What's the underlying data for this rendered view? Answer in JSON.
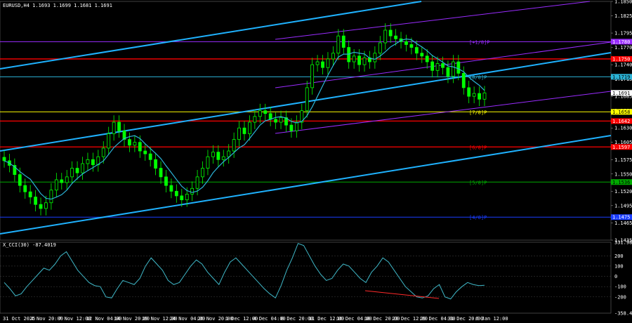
{
  "header": {
    "symbol_line": "EURUSD,H4  1.1693 1.1699 1.1681 1.1691",
    "cci_title": "X_CCI(30) -87.4019"
  },
  "colors": {
    "background": "#000000",
    "bull": "#00ff00",
    "bear": "#00ff00",
    "ma": "#2bb3d6",
    "channel": "#1fb2ff",
    "purple": "#9a2cff",
    "red_level": "#ff0000",
    "yellow_level": "#ffff00",
    "green_level": "#00aa00",
    "blue_level": "#1a3dff",
    "cci_line": "#3fb8c8",
    "div_line": "#ff2a2a"
  },
  "price_axis": {
    "min": 1.1435,
    "max": 1.185,
    "ticks": [
      "1.1850",
      "1.1825",
      "1.1795",
      "1.1770",
      "1.1740",
      "1.1715",
      "1.1685",
      "1.1660",
      "1.1630",
      "1.1605",
      "1.1575",
      "1.1550",
      "1.1520",
      "1.1495",
      "1.1465",
      "1.1435"
    ],
    "current_price": "1.1691"
  },
  "murray_levels": [
    {
      "price": 1.178,
      "tag": "[+1/8]P",
      "label": "1.1780",
      "color": "#9a2cff"
    },
    {
      "price": 1.175,
      "tag": "",
      "label": "1.1750",
      "color": "#ff0000"
    },
    {
      "price": 1.1719,
      "tag": "[8/8]P",
      "label": "1.1719",
      "color": "#2bb3d6"
    },
    {
      "price": 1.1658,
      "tag": "[7/8]P",
      "label": "1.1658",
      "color": "#ffff00"
    },
    {
      "price": 1.1642,
      "tag": "",
      "label": "1.1642",
      "color": "#ff0000"
    },
    {
      "price": 1.1597,
      "tag": "[6/8]P",
      "label": "1.1597",
      "color": "#ff0000"
    },
    {
      "price": 1.1536,
      "tag": "[5/8]P",
      "label": "1.1536",
      "color": "#00aa00"
    },
    {
      "price": 1.1475,
      "tag": "[4/8]P",
      "label": "1.1475",
      "color": "#1a3dff"
    }
  ],
  "time_axis": [
    "31 Oct 2025",
    "4 Nov 20:00",
    "7 Nov 12:00",
    "12 Nov 04:00",
    "14 Nov 20:00",
    "19 Nov 12:00",
    "24 Nov 04:00",
    "26 Nov 20:00",
    "1 Dec 12:00",
    "4 Dec 04:00",
    "8 Dec 20:00",
    "11 Dec 12:00",
    "16 Dec 04:00",
    "18 Dec 20:00",
    "23 Dec 12:00",
    "29 Dec 04:00",
    "31 Dec 20:00",
    "6 Jan 12:00"
  ],
  "cci_axis": {
    "ticks": [
      "331.986",
      "200",
      "100",
      "0",
      "-100",
      "-200",
      "-358.438"
    ]
  },
  "close_series": [
    1.1573,
    1.1565,
    1.1549,
    1.153,
    1.1519,
    1.151,
    1.1497,
    1.149,
    1.15,
    1.1522,
    1.154,
    1.1535,
    1.1545,
    1.156,
    1.1552,
    1.1568,
    1.1575,
    1.1566,
    1.158,
    1.1595,
    1.162,
    1.164,
    1.1625,
    1.161,
    1.16,
    1.1605,
    1.159,
    1.1585,
    1.1575,
    1.156,
    1.1545,
    1.153,
    1.152,
    1.1512,
    1.1505,
    1.1515,
    1.1525,
    1.1545,
    1.156,
    1.158,
    1.1588,
    1.1575,
    1.158,
    1.159,
    1.161,
    1.163,
    1.162,
    1.164,
    1.165,
    1.166,
    1.1655,
    1.1645,
    1.164,
    1.1648,
    1.1635,
    1.1625,
    1.164,
    1.166,
    1.17,
    1.174,
    1.1745,
    1.1735,
    1.175,
    1.176,
    1.179,
    1.177,
    1.1745,
    1.1755,
    1.174,
    1.1752,
    1.1745,
    1.176,
    1.1778,
    1.18,
    1.179,
    1.1785,
    1.178,
    1.1775,
    1.177,
    1.176,
    1.1755,
    1.1745,
    1.173,
    1.1742,
    1.1735,
    1.172,
    1.1745,
    1.1725,
    1.17,
    1.1685,
    1.169,
    1.168,
    1.1691
  ],
  "cci_series": [
    -60,
    -120,
    -190,
    -170,
    -100,
    -40,
    20,
    80,
    60,
    120,
    200,
    240,
    150,
    60,
    0,
    -60,
    -90,
    -100,
    -200,
    -210,
    -120,
    -40,
    -60,
    -80,
    -20,
    100,
    180,
    120,
    60,
    -40,
    -80,
    -60,
    20,
    100,
    160,
    120,
    40,
    -20,
    -80,
    40,
    140,
    180,
    120,
    60,
    0,
    -60,
    -120,
    -170,
    -210,
    -90,
    60,
    180,
    320,
    300,
    200,
    100,
    20,
    -40,
    -20,
    60,
    120,
    100,
    40,
    -20,
    -60,
    40,
    100,
    180,
    140,
    60,
    -20,
    -100,
    -150,
    -200,
    -210,
    -190,
    -120,
    -80,
    -200,
    -220,
    -150,
    -100,
    -60,
    -80,
    -90,
    -87
  ]
}
